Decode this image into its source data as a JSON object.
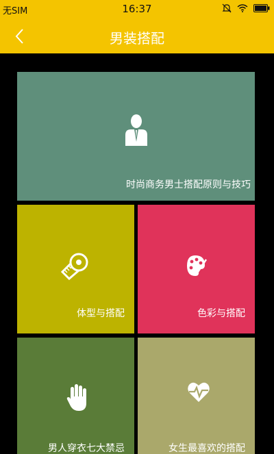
{
  "status": {
    "carrier": "无SIM",
    "time": "16:37"
  },
  "header": {
    "title": "男装搭配"
  },
  "tiles": [
    {
      "label": "时尚商务男士搭配原则与技巧",
      "color": "#5f8f7b",
      "icon": "businessman-icon"
    },
    {
      "label": "体型与搭配",
      "color": "#bdb300",
      "icon": "tape-measure-icon"
    },
    {
      "label": "色彩与搭配",
      "color": "#e0335a",
      "icon": "palette-icon"
    },
    {
      "label": "男人穿衣七大禁忌",
      "color": "#5a7c38",
      "icon": "hand-icon"
    },
    {
      "label": "女生最喜欢的搭配",
      "color": "#aaa86b",
      "icon": "heart-pulse-icon"
    }
  ]
}
